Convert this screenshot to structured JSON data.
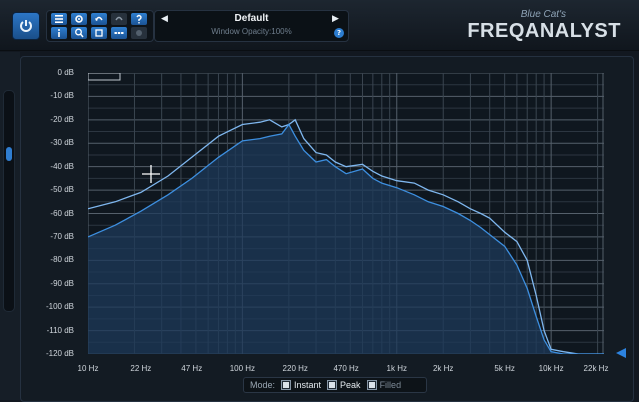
{
  "header": {
    "preset_name": "Default",
    "preset_sub": "Window Opacity:100%",
    "brand_top": "Blue Cat's",
    "brand_main": "FREQANALYST"
  },
  "icons": {
    "power": "power-icon",
    "menu": "menu-icon",
    "settings": "gear-icon",
    "undo": "undo-icon",
    "redo": "redo-icon",
    "help": "help-icon",
    "info": "info-icon",
    "zoom": "magnifier-icon",
    "copy": "copy-icon",
    "more": "more-icon",
    "disabled": "disabled-icon"
  },
  "plot": {
    "y_ticks": [
      "0 dB",
      "-10 dB",
      "-20 dB",
      "-30 dB",
      "-40 dB",
      "-50 dB",
      "-60 dB",
      "-70 dB",
      "-80 dB",
      "-90 dB",
      "-100 dB",
      "-110 dB",
      "-120 dB"
    ],
    "x_ticks": [
      "10 Hz",
      "22 Hz",
      "47 Hz",
      "100 Hz",
      "220 Hz",
      "470 Hz",
      "1k Hz",
      "2k Hz",
      "5k Hz",
      "10k Hz",
      "22k Hz"
    ]
  },
  "chart_data": {
    "type": "line",
    "title": "",
    "xlabel": "",
    "ylabel": "",
    "x_scale": "log",
    "xlim": [
      10,
      22000
    ],
    "ylim": [
      -120,
      0
    ],
    "grid": true,
    "series": [
      {
        "x": [
          10,
          15,
          22,
          33,
          47,
          70,
          100,
          130,
          150,
          180,
          200,
          220,
          250,
          300,
          350,
          400,
          470,
          600,
          700,
          800,
          1000,
          1300,
          1600,
          2000,
          2500,
          3000,
          3500,
          4000,
          5000,
          6000,
          7000,
          8000,
          9000,
          10000,
          12000,
          15000,
          18000,
          22000
        ],
        "y": [
          -58,
          -55,
          -51,
          -44,
          -36,
          -27,
          -22,
          -21,
          -20,
          -23,
          -22,
          -20,
          -28,
          -34,
          -35,
          -38,
          -40,
          -39,
          -42,
          -44,
          -46,
          -47,
          -50,
          -52,
          -55,
          -58,
          -60,
          -62,
          -68,
          -72,
          -80,
          -95,
          -110,
          -118,
          -119,
          -120,
          -120,
          -120
        ]
      },
      {
        "x": [
          10,
          15,
          22,
          33,
          47,
          70,
          100,
          130,
          150,
          180,
          200,
          220,
          250,
          300,
          350,
          400,
          470,
          600,
          700,
          800,
          1000,
          1300,
          1600,
          2000,
          2500,
          3000,
          3500,
          4000,
          5000,
          6000,
          7000,
          8000,
          9000,
          10000,
          12000,
          15000,
          18000,
          22000
        ],
        "y": [
          -70,
          -65,
          -59,
          -52,
          -45,
          -36,
          -29,
          -28,
          -27,
          -26,
          -22,
          -27,
          -33,
          -38,
          -37,
          -40,
          -43,
          -41,
          -45,
          -47,
          -49,
          -52,
          -55,
          -57,
          -60,
          -63,
          -66,
          -69,
          -74,
          -82,
          -92,
          -104,
          -114,
          -119,
          -120,
          -120,
          -120,
          -120
        ]
      }
    ]
  },
  "mode": {
    "label": "Mode:",
    "instant": "Instant",
    "peak": "Peak",
    "filled": "Filled",
    "instant_checked": true,
    "peak_checked": true,
    "filled_checked": true
  },
  "colors": {
    "accent": "#2c83e0",
    "curve": "#3d8fe0",
    "curve_light": "#7fb7ef",
    "fill": "#1d3a5a"
  }
}
